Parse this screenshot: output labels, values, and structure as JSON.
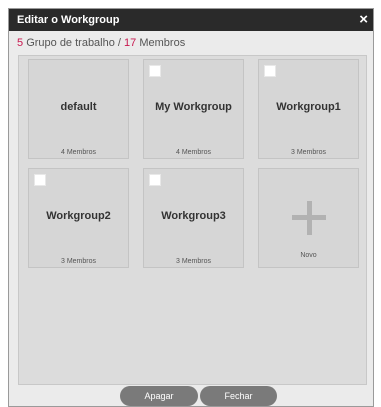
{
  "dialog": {
    "title": "Editar o Workgroup",
    "close_glyph": "×"
  },
  "summary": {
    "group_count": "5",
    "group_label": "Grupo de trabalho /",
    "member_count": "17",
    "member_label": "Membros"
  },
  "workgroups": [
    {
      "name": "default",
      "members": "4 Membros",
      "has_checkbox": false
    },
    {
      "name": "My Workgroup",
      "members": "4 Membros",
      "has_checkbox": true
    },
    {
      "name": "Workgroup1",
      "members": "3 Membros",
      "has_checkbox": true
    },
    {
      "name": "Workgroup2",
      "members": "3 Membros",
      "has_checkbox": true
    },
    {
      "name": "Workgroup3",
      "members": "3 Membros",
      "has_checkbox": true
    }
  ],
  "new_card": {
    "label": "Novo",
    "icon": "plus-icon"
  },
  "buttons": {
    "delete_label": "Apagar",
    "close_label": "Fechar"
  },
  "colors": {
    "titlebar": "#2a2a2a",
    "accent": "#c8174e",
    "button": "#7a7a7a"
  }
}
